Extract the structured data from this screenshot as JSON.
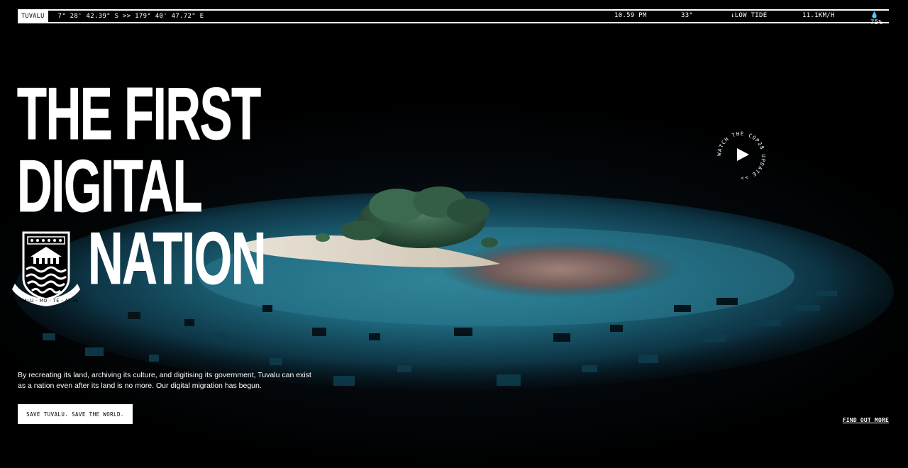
{
  "statusbar": {
    "location": "TUVALU",
    "coords": "7° 28' 42.39\" S >> 179° 40' 47.72\" E",
    "time": "10.59 PM",
    "temperature": "33°",
    "tide": "↓LOW TIDE",
    "wind": "11.1KM/H",
    "humidity": "💧75%"
  },
  "hero": {
    "headline_line1": "THE FIRST",
    "headline_line2": "DIGITAL",
    "headline_line3": "NATION",
    "crest_motto": "TUVALU · MO · TE · ATUA",
    "description": "By recreating its land, archiving its culture, and digitising its government, Tuvalu can exist as a nation even after its land is no more. Our digital migration has begun.",
    "cta_label": "SAVE TUVALU. SAVE THE WORLD.",
    "find_out_more": "FIND OUT MORE"
  },
  "watch_badge": {
    "ring_text": "WATCH THE COP28 UPDATE >>",
    "icon": "play-icon"
  },
  "colors": {
    "background": "#000000",
    "ocean": "#1f6a80",
    "sand": "#d9d2c4",
    "foreground": "#ffffff"
  }
}
